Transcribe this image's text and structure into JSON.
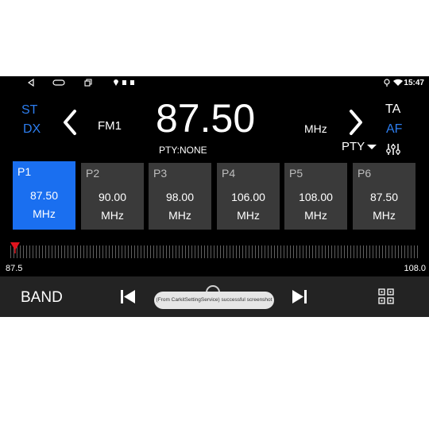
{
  "statusbar": {
    "time": "15:47"
  },
  "tuner": {
    "st": "ST",
    "dx": "DX",
    "band_name": "FM1",
    "frequency": "87.50",
    "unit": "MHz",
    "pty_info": "PTY:NONE",
    "ta": "TA",
    "af": "AF",
    "pty_button": "PTY"
  },
  "presets": [
    {
      "name": "P1",
      "freq": "87.50",
      "unit": "MHz",
      "active": true
    },
    {
      "name": "P2",
      "freq": "90.00",
      "unit": "MHz",
      "active": false
    },
    {
      "name": "P3",
      "freq": "98.00",
      "unit": "MHz",
      "active": false
    },
    {
      "name": "P4",
      "freq": "106.00",
      "unit": "MHz",
      "active": false
    },
    {
      "name": "P5",
      "freq": "108.00",
      "unit": "MHz",
      "active": false
    },
    {
      "name": "P6",
      "freq": "87.50",
      "unit": "MHz",
      "active": false
    }
  ],
  "scale": {
    "min": "87.5",
    "max": "108.0",
    "current": 87.5
  },
  "bottombar": {
    "band_label": "BAND"
  },
  "toast": {
    "text": "(From CarkitSettingService) successful screenshot"
  },
  "colors": {
    "accent": "#1a6ff0",
    "label_blue": "#2d7ef0",
    "needle": "#e0141e"
  }
}
